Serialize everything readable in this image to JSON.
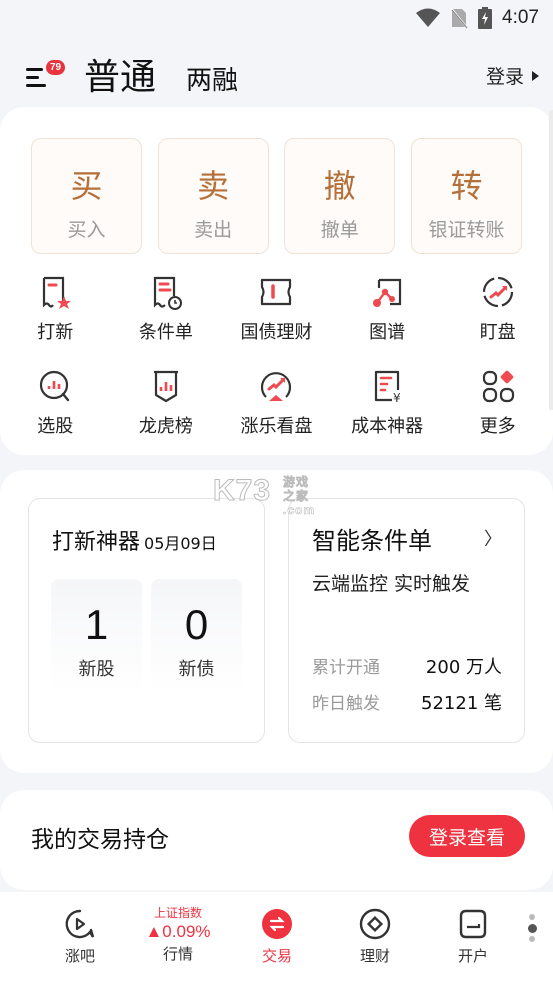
{
  "status_bar": {
    "time": "4:07",
    "icons": [
      "wifi-icon",
      "no-sim-icon",
      "battery-charging-icon"
    ]
  },
  "header": {
    "menu_badge": "79",
    "title_main": "普通",
    "title_sub": "两融",
    "login_label": "登录"
  },
  "trade_buttons": [
    {
      "big": "买",
      "small": "买入"
    },
    {
      "big": "卖",
      "small": "卖出"
    },
    {
      "big": "撤",
      "small": "撤单"
    },
    {
      "big": "转",
      "small": "银证转账"
    }
  ],
  "features": [
    {
      "label": "打新",
      "icon": "ipo-ticket-star-icon"
    },
    {
      "label": "条件单",
      "icon": "condition-order-clock-icon"
    },
    {
      "label": "国债理财",
      "icon": "bond-ticket-icon"
    },
    {
      "label": "图谱",
      "icon": "graph-nodes-icon"
    },
    {
      "label": "盯盘",
      "icon": "watch-trend-icon"
    },
    {
      "label": "选股",
      "icon": "stock-search-icon"
    },
    {
      "label": "龙虎榜",
      "icon": "ranking-banner-icon"
    },
    {
      "label": "涨乐看盘",
      "icon": "market-view-icon"
    },
    {
      "label": "成本神器",
      "icon": "cost-yen-icon"
    },
    {
      "label": "更多",
      "icon": "more-apps-icon"
    }
  ],
  "ipo_tool": {
    "title": "打新神器",
    "date": "05月09日",
    "stats": [
      {
        "value": "1",
        "label": "新股"
      },
      {
        "value": "0",
        "label": "新债"
      }
    ]
  },
  "smart_order": {
    "title": "智能条件单",
    "arrow": "〉",
    "desc": "云端监控 实时触发",
    "rows": [
      {
        "key": "累计开通",
        "value": "200 万人"
      },
      {
        "key": "昨日触发",
        "value": "52121 笔"
      }
    ]
  },
  "watermark": {
    "logo": "K73",
    "text1": "游戏之家",
    "text2": ".com"
  },
  "holdings": {
    "title": "我的交易持仓",
    "button": "登录查看"
  },
  "bottom_nav": {
    "market_index_name": "上证指数",
    "market_index_change": "▲0.09%",
    "items": [
      {
        "label": "涨吧",
        "icon": "play-bubble-icon"
      },
      {
        "label": "行情",
        "icon": ""
      },
      {
        "label": "交易",
        "icon": "exchange-icon"
      },
      {
        "label": "理财",
        "icon": "coin-diamond-icon"
      },
      {
        "label": "开户",
        "icon": "account-open-icon"
      }
    ],
    "active": "交易"
  },
  "colors": {
    "accent": "#ee3240",
    "trade_gold": "#b5703a",
    "background": "#f4f5f9"
  }
}
